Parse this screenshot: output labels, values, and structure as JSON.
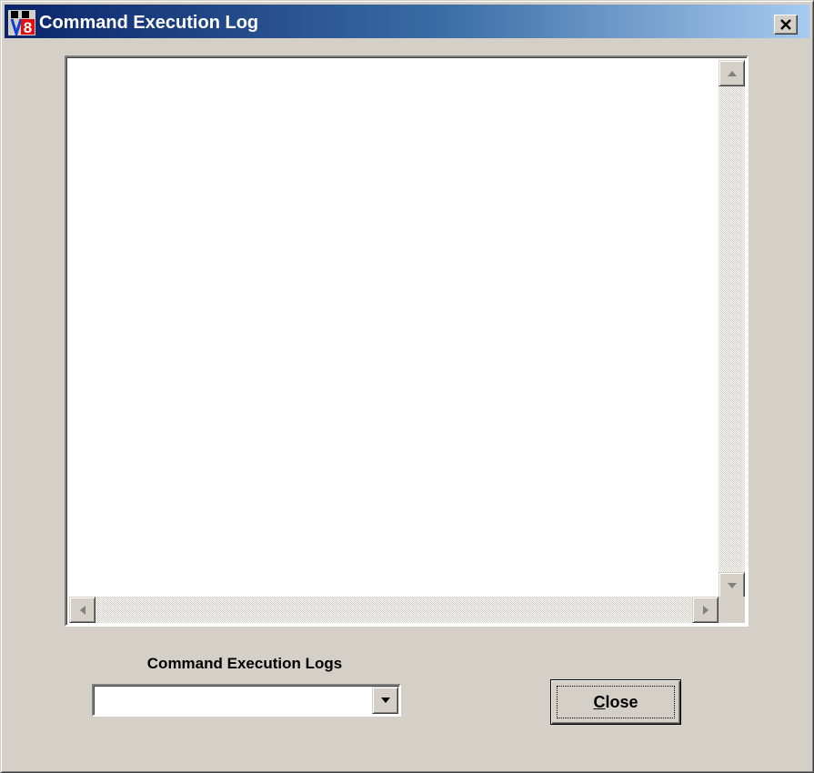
{
  "window": {
    "title": "Command Execution Log",
    "title_colors": {
      "start": "#0a246a",
      "end": "#a6caf0"
    },
    "close_icon": "close-x-icon"
  },
  "log": {
    "text": ""
  },
  "logs_selector": {
    "label": "Command Execution Logs",
    "selected_value": ""
  },
  "close_button": {
    "mnemonic": "C",
    "label_rest": "lose"
  }
}
